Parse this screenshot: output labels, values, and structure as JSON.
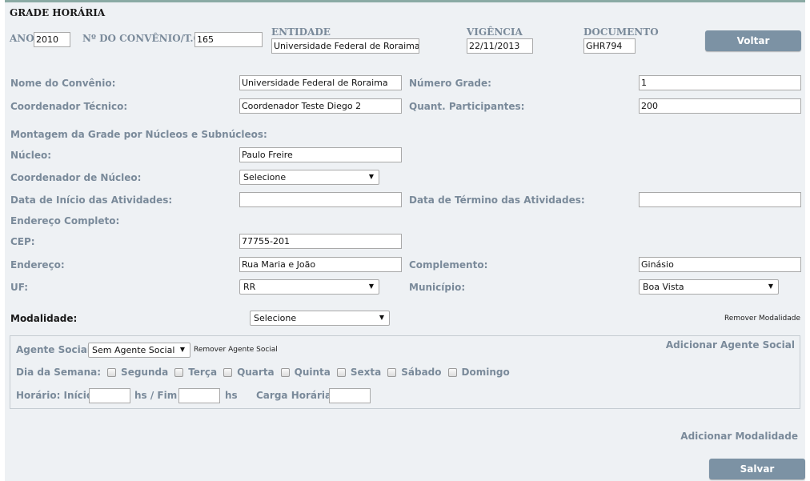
{
  "header": {
    "title": "GRADE HORÁRIA",
    "ano_label": "ANO",
    "ano_value": "2010",
    "convenio_label": "Nº DO CONVÊNIO/T.C.",
    "convenio_value": "165",
    "entidade_label": "ENTIDADE",
    "entidade_value": "Universidade Federal de Roraima",
    "vigencia_label": "VIGÊNCIA",
    "vigencia_value": "22/11/2013",
    "documento_label": "DOCUMENTO",
    "documento_value": "GHR794",
    "voltar_label": "Voltar"
  },
  "form": {
    "nome_convenio_label": "Nome do Convênio:",
    "nome_convenio_value": "Universidade Federal de Roraima",
    "numero_grade_label": "Número Grade:",
    "numero_grade_value": "1",
    "coordenador_tecnico_label": "Coordenador Técnico:",
    "coordenador_tecnico_value": "Coordenador Teste Diego 2",
    "quant_participantes_label": "Quant. Participantes:",
    "quant_participantes_value": "200",
    "montagem_label": "Montagem da Grade por Núcleos e Subnúcleos:",
    "nucleo_label": "Núcleo:",
    "nucleo_value": "Paulo Freire",
    "coord_nucleo_label": "Coordenador de Núcleo:",
    "coord_nucleo_value": "Selecione",
    "data_inicio_label": "Data de Início das Atividades:",
    "data_inicio_value": "",
    "data_termino_label": "Data de Término das Atividades:",
    "data_termino_value": "",
    "endereco_completo_label": "Endereço Completo:",
    "cep_label": "CEP:",
    "cep_value": "77755-201",
    "endereco_label": "Endereço:",
    "endereco_value": "Rua Maria e João",
    "complemento_label": "Complemento:",
    "complemento_value": "Ginásio",
    "uf_label": "UF:",
    "uf_value": "RR",
    "municipio_label": "Município:",
    "municipio_value": "Boa Vista"
  },
  "modalidade": {
    "label": "Modalidade:",
    "value": "Selecione",
    "remover_label": "Remover Modalidade",
    "agente_social_label": "Agente Social:",
    "agente_social_value": "Sem Agente Social",
    "remover_agente_label": "Remover Agente Social",
    "adicionar_agente_label": "Adicionar Agente Social",
    "dia_semana_label": "Dia da Semana:",
    "days": [
      "Segunda",
      "Terça",
      "Quarta",
      "Quinta",
      "Sexta",
      "Sábado",
      "Domingo"
    ],
    "horario_inicio_label": "Horário: Início",
    "hs_fim_label": "hs / Fim",
    "hs_label": "hs",
    "carga_horaria_label": "Carga Horária:",
    "horario_inicio_value": "",
    "horario_fim_value": "",
    "carga_horaria_value": ""
  },
  "footer": {
    "adicionar_modalidade_label": "Adicionar Modalidade",
    "salvar_label": "Salvar"
  }
}
